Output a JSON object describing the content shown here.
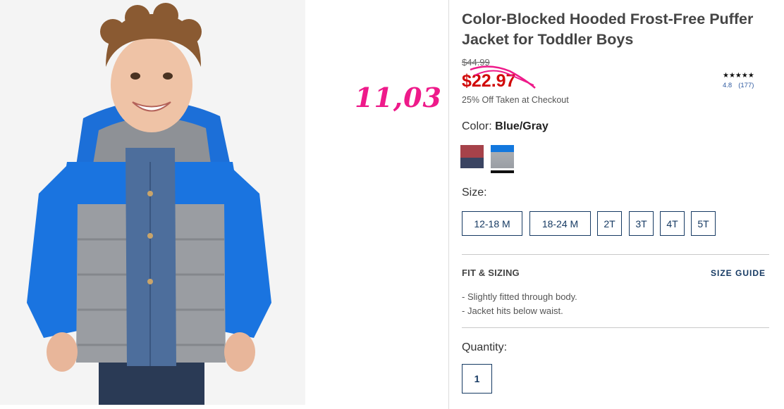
{
  "product": {
    "title": "Color-Blocked Hooded Frost-Free Puffer Jacket for Toddler Boys",
    "original_price": "$44.99",
    "sale_price": "$22.97",
    "promo_text": "25% Off Taken at Checkout"
  },
  "annotation": {
    "handwritten_price": "11,03",
    "color": "#ee1a8a"
  },
  "rating": {
    "stars": "★★★★★",
    "score": "4.8",
    "count": "(177)"
  },
  "color": {
    "label": "Color:",
    "selected": "Blue/Gray",
    "swatches": [
      {
        "name": "red-navy",
        "colors": [
          "#a6424a",
          "#3a4462"
        ]
      },
      {
        "name": "blue-gray",
        "colors": [
          "#1378de",
          "#a9adb2"
        ],
        "selected": true
      }
    ]
  },
  "size": {
    "label": "Size:",
    "options": [
      "12-18 M",
      "18-24 M",
      "2T",
      "3T",
      "4T",
      "5T"
    ]
  },
  "fit": {
    "heading": "FIT & SIZING",
    "size_guide": "SIZE GUIDE",
    "bullets": [
      "-  Slightly fitted through body.",
      "-  Jacket hits below waist."
    ]
  },
  "quantity": {
    "label": "Quantity:",
    "value": "1"
  },
  "colors": {
    "sale_red": "#d10a0a",
    "navy": "#163a63",
    "jacket_blue": "#1378de",
    "jacket_gray": "#9a9ea4"
  }
}
